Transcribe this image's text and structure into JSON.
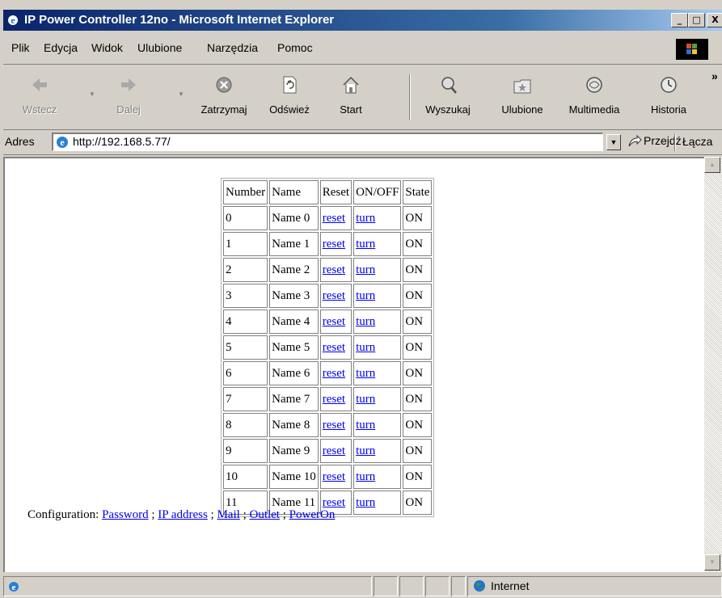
{
  "window": {
    "title": "IP Power Controller 12no - Microsoft Internet Explorer",
    "controls": {
      "minimize": "_",
      "maximize": "□",
      "close": "X"
    }
  },
  "menu": [
    "Plik",
    "Edycja",
    "Widok",
    "Ulubione",
    "Narzędzia",
    "Pomoc"
  ],
  "toolbar": {
    "back": "Wstecz",
    "forward": "Dalej",
    "stop": "Zatrzymaj",
    "refresh": "Odśwież",
    "home": "Start",
    "search": "Wyszukaj",
    "favorites": "Ulubione",
    "media": "Multimedia",
    "history": "Historia",
    "more": "»"
  },
  "address": {
    "label": "Adres",
    "url": "http://192.168.5.77/",
    "go": "Przejdź",
    "links": "Łącza"
  },
  "table": {
    "headers": [
      "Number",
      "Name",
      "Reset",
      "ON/OFF",
      "State"
    ],
    "rows": [
      [
        "0",
        "Name 0",
        "reset",
        "turn",
        "ON"
      ],
      [
        "1",
        "Name 1",
        "reset",
        "turn",
        "ON"
      ],
      [
        "2",
        "Name 2",
        "reset",
        "turn",
        "ON"
      ],
      [
        "3",
        "Name 3",
        "reset",
        "turn",
        "ON"
      ],
      [
        "4",
        "Name 4",
        "reset",
        "turn",
        "ON"
      ],
      [
        "5",
        "Name 5",
        "reset",
        "turn",
        "ON"
      ],
      [
        "6",
        "Name 6",
        "reset",
        "turn",
        "ON"
      ],
      [
        "7",
        "Name 7",
        "reset",
        "turn",
        "ON"
      ],
      [
        "8",
        "Name 8",
        "reset",
        "turn",
        "ON"
      ],
      [
        "9",
        "Name 9",
        "reset",
        "turn",
        "ON"
      ],
      [
        "10",
        "Name 10",
        "reset",
        "turn",
        "ON"
      ],
      [
        "11",
        "Name 11",
        "reset",
        "turn",
        "ON"
      ]
    ]
  },
  "config": {
    "label": "Configuration:",
    "links": [
      "Password",
      "IP address",
      "Mail",
      "Outlet",
      "PowerOn"
    ],
    "separator": ";"
  },
  "status": {
    "zone": "Internet"
  },
  "colors": {
    "titlebar": "#0a246a",
    "face": "#d4d0c8",
    "link": "#0000ee"
  }
}
